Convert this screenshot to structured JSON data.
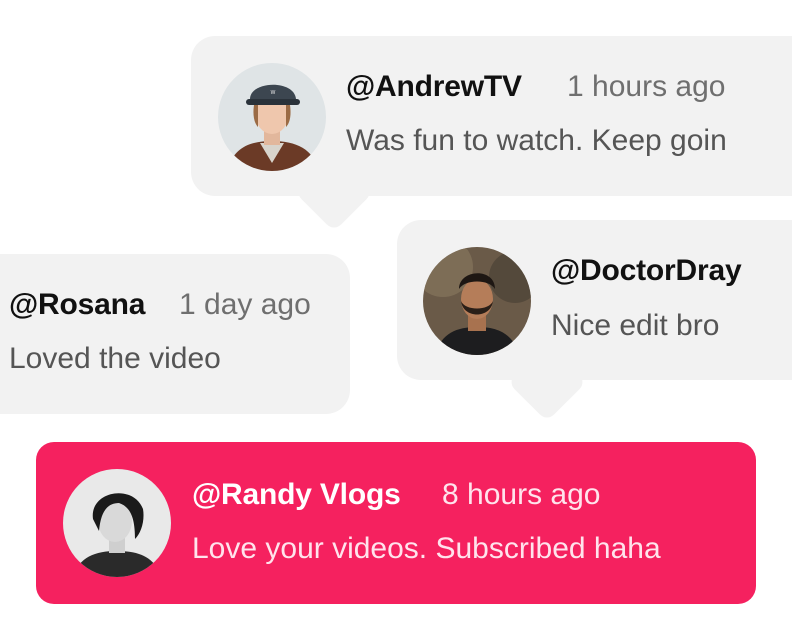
{
  "comments": [
    {
      "handle": "@AndrewTV",
      "time": "1 hours ago",
      "text": "Was fun to watch. Keep goin",
      "avatar_icon": "avatar-photo-andrew"
    },
    {
      "handle": "@DoctorDray",
      "time": "",
      "text": "Nice edit bro",
      "avatar_icon": "avatar-photo-doctordray"
    },
    {
      "handle": "@Rosana",
      "time": "1 day ago",
      "text": "Loved the video"
    },
    {
      "handle": "@Randy Vlogs",
      "time": "8 hours ago",
      "text": "Love your videos. Subscribed haha",
      "avatar_icon": "avatar-photo-randy",
      "highlighted": true
    }
  ],
  "colors": {
    "bubble_bg": "#f2f2f2",
    "highlight_bg": "#f5215f",
    "handle_text": "#111111",
    "muted_text": "#6f6f6f"
  }
}
